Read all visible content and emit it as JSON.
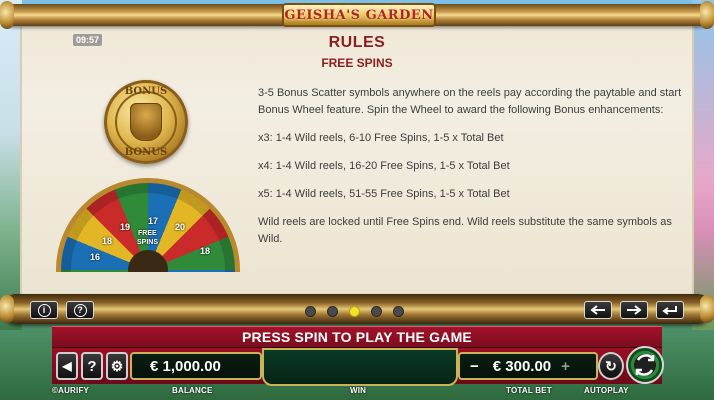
{
  "logo": {
    "text": "GEISHA'S GARDEN"
  },
  "clock": "09:57",
  "rules": {
    "title": "RULES",
    "section": "FREE SPINS",
    "paragraphs": [
      "3-5 Bonus Scatter symbols anywhere on the reels pay according the paytable and start Bonus Wheel feature. Spin the Wheel to award the following Bonus enhancements:",
      "x3: 1-4 Wild reels, 6-10 Free Spins, 1-5 x Total Bet",
      "x4: 1-4 Wild reels, 16-20 Free Spins, 1-5 x Total Bet",
      "x5: 1-4 Wild reels, 51-55 Free Spins, 1-5 x Total Bet",
      "Wild reels are locked until Free Spins end. Wild reels substitute the same symbols as Wild."
    ]
  },
  "coin": {
    "top": "BONUS",
    "bottom": "BONUS"
  },
  "wheel_labels": [
    "18",
    "19",
    "17",
    "20",
    "16",
    "18",
    "FREE",
    "SPINS"
  ],
  "pagination": {
    "pages": 5,
    "active": 3
  },
  "toolbar": {
    "info": "i",
    "help": "?"
  },
  "banner": "PRESS SPIN TO PLAY THE GAME",
  "controls": {
    "sound": "◀",
    "help": "?",
    "settings": "⚙",
    "balance": "€ 1,000.00",
    "win": "",
    "bet_minus": "−",
    "total_bet": "€ 300.00",
    "bet_plus": "+",
    "autoplay": "↻"
  },
  "labels": {
    "brand": "©AURIFY",
    "balance": "BALANCE",
    "win": "WIN",
    "total_bet": "TOTAL BET",
    "autoplay": "AUTOPLAY"
  },
  "colors": {
    "title": "#8a1f1f",
    "banner": "#a3122a",
    "active_dot": "#f3e22a"
  }
}
